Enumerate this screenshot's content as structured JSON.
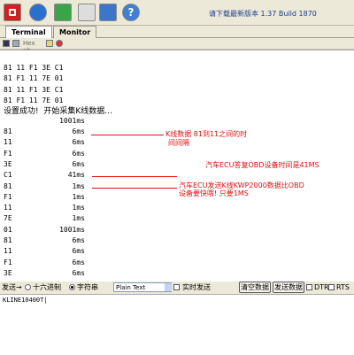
{
  "header": {
    "build_text": "请下载最新版本 1.37 Build 1870"
  },
  "tabs": [
    "Terminal",
    "Monitor"
  ],
  "minibar": {
    "hex_label": "Hex ab"
  },
  "terminal": {
    "hex_lines": [
      "81 11 F1 3E C1",
      "81 F1 11 7E 01",
      "81 11 F1 3E C1",
      "81 F1 11 7E 01"
    ],
    "status": "设置成功!  开始采集K线数据...",
    "first_value": "1001ms",
    "rows": [
      [
        "81",
        "6ms"
      ],
      [
        "11",
        "6ms"
      ],
      [
        "F1",
        "6ms"
      ],
      [
        "3E",
        "6ms"
      ],
      [
        "C1",
        "41ms"
      ],
      [
        "81",
        "1ms"
      ],
      [
        "F1",
        "1ms"
      ],
      [
        "11",
        "1ms"
      ],
      [
        "7E",
        "1ms"
      ],
      [
        "01",
        "1001ms"
      ],
      [
        "81",
        "6ms"
      ],
      [
        "11",
        "6ms"
      ],
      [
        "F1",
        "6ms"
      ],
      [
        "3E",
        "6ms"
      ]
    ],
    "notes": {
      "n1a": "K线数据 81到11之间的时",
      "n1b": "间间隔",
      "n2": "汽车ECU答复OBD设备时间是41MS",
      "n3a": "汽车ECU发送K线KWP2000数据比OBD",
      "n3b": "设备要快哦!  只要1MS"
    }
  },
  "bottom": {
    "send_label": "发送→",
    "radio_hex": "十六进制",
    "radio_str": "字符串",
    "combo_value": "Plain Text",
    "realtime": "实时发送",
    "clear_btn": "清空数据",
    "send_btn": "发送数据",
    "dtr": "DTR",
    "rts": "RTS"
  },
  "input": {
    "value": "KLINE10400T|"
  }
}
